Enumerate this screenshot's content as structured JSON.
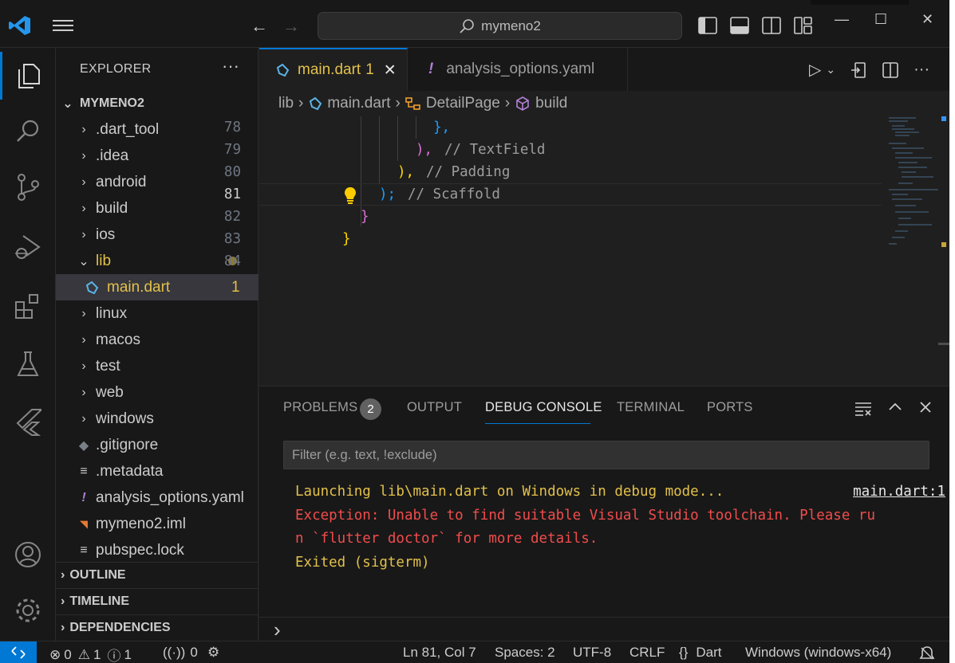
{
  "titlebar": {
    "search_text": "mymeno2",
    "back_glyph": "←",
    "forward_glyph": "→",
    "minimize_glyph": "—",
    "maximize_glyph": "☐",
    "close_glyph": "✕"
  },
  "activity": {
    "items": [
      "explorer-icon",
      "search-icon",
      "source-control-icon",
      "run-debug-icon",
      "extensions-icon",
      "testing-icon",
      "flutter-icon"
    ],
    "bottom_items": [
      "accounts-icon",
      "settings-gear-icon"
    ]
  },
  "explorer": {
    "title": "EXPLORER",
    "more": "···",
    "root": "MYMENO2",
    "items": [
      {
        "label": ".dart_tool",
        "type": "folder"
      },
      {
        "label": ".idea",
        "type": "folder"
      },
      {
        "label": "android",
        "type": "folder"
      },
      {
        "label": "build",
        "type": "folder"
      },
      {
        "label": "ios",
        "type": "folder"
      },
      {
        "label": "lib",
        "type": "folder-open"
      },
      {
        "label": "main.dart",
        "type": "file",
        "badge": "1"
      },
      {
        "label": "linux",
        "type": "folder"
      },
      {
        "label": "macos",
        "type": "folder"
      },
      {
        "label": "test",
        "type": "folder"
      },
      {
        "label": "web",
        "type": "folder"
      },
      {
        "label": "windows",
        "type": "folder"
      },
      {
        "label": ".gitignore",
        "type": "file"
      },
      {
        "label": ".metadata",
        "type": "file"
      },
      {
        "label": "analysis_options.yaml",
        "type": "file"
      },
      {
        "label": "mymeno2.iml",
        "type": "file"
      },
      {
        "label": "pubspec.lock",
        "type": "file"
      }
    ],
    "sections": [
      "OUTLINE",
      "TIMELINE",
      "DEPENDENCIES"
    ]
  },
  "editor": {
    "tabs": [
      {
        "label": "main.dart",
        "suffix": "1",
        "close": "✕"
      },
      {
        "label": "analysis_options.yaml",
        "prefix": "!"
      }
    ],
    "breadcrumb": [
      "lib",
      "main.dart",
      "DetailPage",
      "build"
    ],
    "lines": [
      {
        "n": "78",
        "code": "},"
      },
      {
        "n": "79",
        "code": "),",
        "comment": "// TextField"
      },
      {
        "n": "80",
        "code": "),",
        "comment": "// Padding"
      },
      {
        "n": "81",
        "code": ");",
        "comment": "// Scaffold"
      },
      {
        "n": "82",
        "code": "}"
      },
      {
        "n": "83",
        "code": "}"
      },
      {
        "n": "84",
        "code": ""
      }
    ]
  },
  "panel": {
    "tabs": [
      "PROBLEMS",
      "OUTPUT",
      "DEBUG CONSOLE",
      "TERMINAL",
      "PORTS"
    ],
    "problems_count": "2",
    "filter_placeholder": "Filter (e.g. text, !exclude)",
    "console": {
      "line1": "Launching lib\\main.dart on Windows in debug mode...",
      "link": "main.dart:1",
      "line2a": "Exception: Unable to find suitable Visual Studio toolchain. Please ru",
      "line2b": "n `flutter doctor` for more details.",
      "line3": "Exited (sigterm)"
    },
    "prompt": "›"
  },
  "statusbar": {
    "errors": "0",
    "warnings": "1",
    "infos": "1",
    "ports": "0",
    "position": "Ln 81, Col 7",
    "spaces": "Spaces: 2",
    "encoding": "UTF-8",
    "eol": "CRLF",
    "language_braces": "{}",
    "language": "Dart",
    "device": "Windows (windows-x64)"
  },
  "colors": {
    "accent": "#0078d4",
    "warning": "#e2c04a",
    "error": "#f14c4c"
  }
}
